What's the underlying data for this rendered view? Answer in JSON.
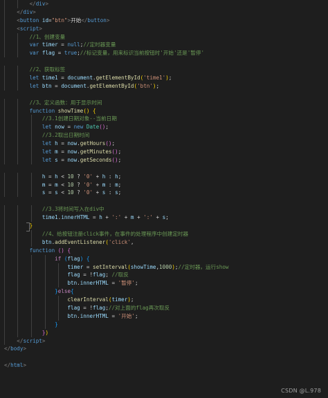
{
  "code": {
    "lines": [
      {
        "id": "l1",
        "indent": 2,
        "tokens": [
          {
            "c": "p",
            "t": "</"
          },
          {
            "c": "t",
            "t": "div"
          },
          {
            "c": "p",
            "t": ">"
          }
        ]
      },
      {
        "id": "l2",
        "indent": 1,
        "tokens": [
          {
            "c": "p",
            "t": "</"
          },
          {
            "c": "t",
            "t": "div"
          },
          {
            "c": "p",
            "t": ">"
          }
        ]
      },
      {
        "id": "l3",
        "indent": 1,
        "tokens": [
          {
            "c": "p",
            "t": "<"
          },
          {
            "c": "t",
            "t": "button"
          },
          {
            "c": "o",
            "t": " "
          },
          {
            "c": "a",
            "t": "id"
          },
          {
            "c": "o",
            "t": "="
          },
          {
            "c": "s",
            "t": "\"btn\""
          },
          {
            "c": "p",
            "t": ">"
          },
          {
            "c": "o",
            "t": "开始"
          },
          {
            "c": "p",
            "t": "</"
          },
          {
            "c": "t",
            "t": "button"
          },
          {
            "c": "p",
            "t": ">"
          }
        ]
      },
      {
        "id": "l4",
        "indent": 1,
        "tokens": [
          {
            "c": "p",
            "t": "<"
          },
          {
            "c": "t",
            "t": "script"
          },
          {
            "c": "p",
            "t": ">"
          }
        ]
      },
      {
        "id": "l5",
        "indent": 2,
        "tokens": [
          {
            "c": "c",
            "t": "//1、创建变量"
          }
        ]
      },
      {
        "id": "l6",
        "indent": 2,
        "tokens": [
          {
            "c": "k",
            "t": "var"
          },
          {
            "c": "o",
            "t": " "
          },
          {
            "c": "v",
            "t": "timer"
          },
          {
            "c": "o",
            "t": " = "
          },
          {
            "c": "k",
            "t": "null"
          },
          {
            "c": "o",
            "t": ";"
          },
          {
            "c": "c",
            "t": "//定时器变量"
          }
        ]
      },
      {
        "id": "l7",
        "indent": 2,
        "tokens": [
          {
            "c": "k",
            "t": "var"
          },
          {
            "c": "o",
            "t": " "
          },
          {
            "c": "v",
            "t": "flag"
          },
          {
            "c": "o",
            "t": " = "
          },
          {
            "c": "k",
            "t": "true"
          },
          {
            "c": "o",
            "t": ";"
          },
          {
            "c": "c",
            "t": "//标记变量，用来标识当前按钮时'开始'还是'暂停'"
          }
        ]
      },
      {
        "id": "l8",
        "indent": 0,
        "tokens": []
      },
      {
        "id": "l9",
        "indent": 2,
        "tokens": [
          {
            "c": "c",
            "t": "//2、获取标签"
          }
        ]
      },
      {
        "id": "l10",
        "indent": 2,
        "tokens": [
          {
            "c": "k",
            "t": "let"
          },
          {
            "c": "o",
            "t": " "
          },
          {
            "c": "v",
            "t": "time1"
          },
          {
            "c": "o",
            "t": " = "
          },
          {
            "c": "v",
            "t": "document"
          },
          {
            "c": "o",
            "t": "."
          },
          {
            "c": "f",
            "t": "getElementById"
          },
          {
            "c": "b1",
            "t": "("
          },
          {
            "c": "s",
            "t": "'time1'"
          },
          {
            "c": "b1",
            "t": ")"
          },
          {
            "c": "o",
            "t": ";"
          }
        ]
      },
      {
        "id": "l11",
        "indent": 2,
        "tokens": [
          {
            "c": "k",
            "t": "let"
          },
          {
            "c": "o",
            "t": " "
          },
          {
            "c": "v",
            "t": "btn"
          },
          {
            "c": "o",
            "t": " = "
          },
          {
            "c": "v",
            "t": "document"
          },
          {
            "c": "o",
            "t": "."
          },
          {
            "c": "f",
            "t": "getElementById"
          },
          {
            "c": "b1",
            "t": "("
          },
          {
            "c": "s",
            "t": "'btn'"
          },
          {
            "c": "b1",
            "t": ")"
          },
          {
            "c": "o",
            "t": ";"
          }
        ]
      },
      {
        "id": "l12",
        "indent": 0,
        "tokens": []
      },
      {
        "id": "l13",
        "indent": 2,
        "tokens": [
          {
            "c": "c",
            "t": "//3、定义函数：用于显示时间"
          }
        ]
      },
      {
        "id": "l14",
        "indent": 2,
        "tokens": [
          {
            "c": "k",
            "t": "function"
          },
          {
            "c": "o",
            "t": " "
          },
          {
            "c": "f",
            "t": "showTime"
          },
          {
            "c": "b1",
            "t": "()"
          },
          {
            "c": "o",
            "t": " "
          },
          {
            "c": "b1",
            "t": "{"
          }
        ]
      },
      {
        "id": "l15",
        "indent": 3,
        "tokens": [
          {
            "c": "c",
            "t": "//3.1创建日期对象--当前日期"
          }
        ]
      },
      {
        "id": "l16",
        "indent": 3,
        "tokens": [
          {
            "c": "k",
            "t": "let"
          },
          {
            "c": "o",
            "t": " "
          },
          {
            "c": "v",
            "t": "now"
          },
          {
            "c": "o",
            "t": " = "
          },
          {
            "c": "k",
            "t": "new"
          },
          {
            "c": "o",
            "t": " "
          },
          {
            "c": "cl",
            "t": "Date"
          },
          {
            "c": "b2",
            "t": "()"
          },
          {
            "c": "o",
            "t": ";"
          }
        ]
      },
      {
        "id": "l17",
        "indent": 3,
        "tokens": [
          {
            "c": "c",
            "t": "//3.2取出日期时间"
          }
        ]
      },
      {
        "id": "l18",
        "indent": 3,
        "tokens": [
          {
            "c": "k",
            "t": "let"
          },
          {
            "c": "o",
            "t": " "
          },
          {
            "c": "v",
            "t": "h"
          },
          {
            "c": "o",
            "t": " = "
          },
          {
            "c": "v",
            "t": "now"
          },
          {
            "c": "o",
            "t": "."
          },
          {
            "c": "f",
            "t": "getHours"
          },
          {
            "c": "b2",
            "t": "()"
          },
          {
            "c": "o",
            "t": ";"
          }
        ]
      },
      {
        "id": "l19",
        "indent": 3,
        "tokens": [
          {
            "c": "k",
            "t": "let"
          },
          {
            "c": "o",
            "t": " "
          },
          {
            "c": "v",
            "t": "m"
          },
          {
            "c": "o",
            "t": " = "
          },
          {
            "c": "v",
            "t": "now"
          },
          {
            "c": "o",
            "t": "."
          },
          {
            "c": "f",
            "t": "getMinutes"
          },
          {
            "c": "b2",
            "t": "()"
          },
          {
            "c": "o",
            "t": ";"
          }
        ]
      },
      {
        "id": "l20",
        "indent": 3,
        "tokens": [
          {
            "c": "k",
            "t": "let"
          },
          {
            "c": "o",
            "t": " "
          },
          {
            "c": "v",
            "t": "s"
          },
          {
            "c": "o",
            "t": " = "
          },
          {
            "c": "v",
            "t": "now"
          },
          {
            "c": "o",
            "t": "."
          },
          {
            "c": "f",
            "t": "getSeconds"
          },
          {
            "c": "b2",
            "t": "()"
          },
          {
            "c": "o",
            "t": ";"
          }
        ]
      },
      {
        "id": "l21",
        "indent": 0,
        "tokens": []
      },
      {
        "id": "l22",
        "indent": 3,
        "tokens": [
          {
            "c": "v",
            "t": "h"
          },
          {
            "c": "o",
            "t": " = "
          },
          {
            "c": "v",
            "t": "h"
          },
          {
            "c": "o",
            "t": " < "
          },
          {
            "c": "n",
            "t": "10"
          },
          {
            "c": "o",
            "t": " ? "
          },
          {
            "c": "s",
            "t": "'0'"
          },
          {
            "c": "o",
            "t": " + "
          },
          {
            "c": "v",
            "t": "h"
          },
          {
            "c": "o",
            "t": " : "
          },
          {
            "c": "v",
            "t": "h"
          },
          {
            "c": "o",
            "t": ";"
          }
        ]
      },
      {
        "id": "l23",
        "indent": 3,
        "tokens": [
          {
            "c": "v",
            "t": "m"
          },
          {
            "c": "o",
            "t": " = "
          },
          {
            "c": "v",
            "t": "m"
          },
          {
            "c": "o",
            "t": " < "
          },
          {
            "c": "n",
            "t": "10"
          },
          {
            "c": "o",
            "t": " ? "
          },
          {
            "c": "s",
            "t": "'0'"
          },
          {
            "c": "o",
            "t": " + "
          },
          {
            "c": "v",
            "t": "m"
          },
          {
            "c": "o",
            "t": " : "
          },
          {
            "c": "v",
            "t": "m"
          },
          {
            "c": "o",
            "t": ";"
          }
        ]
      },
      {
        "id": "l24",
        "indent": 3,
        "tokens": [
          {
            "c": "v",
            "t": "s"
          },
          {
            "c": "o",
            "t": " = "
          },
          {
            "c": "v",
            "t": "s"
          },
          {
            "c": "o",
            "t": " < "
          },
          {
            "c": "n",
            "t": "10"
          },
          {
            "c": "o",
            "t": " ? "
          },
          {
            "c": "s",
            "t": "'0'"
          },
          {
            "c": "o",
            "t": " + "
          },
          {
            "c": "v",
            "t": "s"
          },
          {
            "c": "o",
            "t": " : "
          },
          {
            "c": "v",
            "t": "s"
          },
          {
            "c": "o",
            "t": ";"
          }
        ]
      },
      {
        "id": "l25",
        "indent": 0,
        "tokens": []
      },
      {
        "id": "l26",
        "indent": 3,
        "tokens": [
          {
            "c": "c",
            "t": "//3.3将时间写入在div中"
          }
        ]
      },
      {
        "id": "l27",
        "indent": 3,
        "tokens": [
          {
            "c": "v",
            "t": "time1"
          },
          {
            "c": "o",
            "t": "."
          },
          {
            "c": "v",
            "t": "innerHTML"
          },
          {
            "c": "o",
            "t": " = "
          },
          {
            "c": "v",
            "t": "h"
          },
          {
            "c": "o",
            "t": " + "
          },
          {
            "c": "s",
            "t": "':'"
          },
          {
            "c": "o",
            "t": " + "
          },
          {
            "c": "v",
            "t": "m"
          },
          {
            "c": "o",
            "t": " + "
          },
          {
            "c": "s",
            "t": "':'"
          },
          {
            "c": "o",
            "t": " + "
          },
          {
            "c": "v",
            "t": "s"
          },
          {
            "c": "o",
            "t": ";"
          }
        ]
      },
      {
        "id": "l28",
        "indent": 2,
        "tokens": [
          {
            "c": "b1",
            "t": "}"
          }
        ]
      },
      {
        "id": "l29",
        "indent": 3,
        "tokens": [
          {
            "c": "c",
            "t": "//4、给按钮注册click事件，在事件的处理程序中创建定时器"
          }
        ]
      },
      {
        "id": "l30",
        "indent": 3,
        "tokens": [
          {
            "c": "v",
            "t": "btn"
          },
          {
            "c": "o",
            "t": "."
          },
          {
            "c": "f",
            "t": "addEventListener"
          },
          {
            "c": "b1",
            "t": "("
          },
          {
            "c": "s",
            "t": "'click'"
          },
          {
            "c": "o",
            "t": ","
          }
        ]
      },
      {
        "id": "l31",
        "indent": 2,
        "tokens": [
          {
            "c": "k",
            "t": "function"
          },
          {
            "c": "o",
            "t": " "
          },
          {
            "c": "b2",
            "t": "()"
          },
          {
            "c": "o",
            "t": " "
          },
          {
            "c": "b2",
            "t": "{"
          }
        ]
      },
      {
        "id": "l32",
        "indent": 4,
        "tokens": [
          {
            "c": "kc",
            "t": "if"
          },
          {
            "c": "o",
            "t": " "
          },
          {
            "c": "b3",
            "t": "("
          },
          {
            "c": "v",
            "t": "flag"
          },
          {
            "c": "b3",
            "t": ")"
          },
          {
            "c": "o",
            "t": " "
          },
          {
            "c": "b3",
            "t": "{"
          }
        ]
      },
      {
        "id": "l33",
        "indent": 5,
        "tokens": [
          {
            "c": "v",
            "t": "timer"
          },
          {
            "c": "o",
            "t": " = "
          },
          {
            "c": "f",
            "t": "setInterval"
          },
          {
            "c": "b1",
            "t": "("
          },
          {
            "c": "v",
            "t": "showTime"
          },
          {
            "c": "o",
            "t": ","
          },
          {
            "c": "n",
            "t": "1000"
          },
          {
            "c": "b1",
            "t": ")"
          },
          {
            "c": "o",
            "t": ";"
          },
          {
            "c": "c",
            "t": "//定时器，运行show"
          }
        ]
      },
      {
        "id": "l34",
        "indent": 5,
        "tokens": [
          {
            "c": "v",
            "t": "flag"
          },
          {
            "c": "o",
            "t": " = !"
          },
          {
            "c": "v",
            "t": "flag"
          },
          {
            "c": "o",
            "t": "; "
          },
          {
            "c": "c",
            "t": "//取反"
          }
        ]
      },
      {
        "id": "l35",
        "indent": 5,
        "tokens": [
          {
            "c": "v",
            "t": "btn"
          },
          {
            "c": "o",
            "t": "."
          },
          {
            "c": "v",
            "t": "innerHTML"
          },
          {
            "c": "o",
            "t": " = "
          },
          {
            "c": "s",
            "t": "'暂停'"
          },
          {
            "c": "o",
            "t": ";"
          }
        ]
      },
      {
        "id": "l36",
        "indent": 4,
        "tokens": [
          {
            "c": "b3",
            "t": "}"
          },
          {
            "c": "kc",
            "t": "else"
          },
          {
            "c": "b3",
            "t": "{"
          }
        ]
      },
      {
        "id": "l37",
        "indent": 5,
        "tokens": [
          {
            "c": "f",
            "t": "clearInterval"
          },
          {
            "c": "b1",
            "t": "("
          },
          {
            "c": "v",
            "t": "timer"
          },
          {
            "c": "b1",
            "t": ")"
          },
          {
            "c": "o",
            "t": ";"
          }
        ]
      },
      {
        "id": "l38",
        "indent": 5,
        "tokens": [
          {
            "c": "v",
            "t": "flag"
          },
          {
            "c": "o",
            "t": " = !"
          },
          {
            "c": "v",
            "t": "flag"
          },
          {
            "c": "o",
            "t": ";"
          },
          {
            "c": "c",
            "t": "//对上面的flag再次取反"
          }
        ]
      },
      {
        "id": "l39",
        "indent": 5,
        "tokens": [
          {
            "c": "v",
            "t": "btn"
          },
          {
            "c": "o",
            "t": "."
          },
          {
            "c": "v",
            "t": "innerHTML"
          },
          {
            "c": "o",
            "t": " = "
          },
          {
            "c": "s",
            "t": "'开始'"
          },
          {
            "c": "o",
            "t": ";"
          }
        ]
      },
      {
        "id": "l40",
        "indent": 4,
        "tokens": [
          {
            "c": "b3",
            "t": "}"
          }
        ]
      },
      {
        "id": "l41",
        "indent": 3,
        "tokens": [
          {
            "c": "b2",
            "t": "}"
          },
          {
            "c": "b1",
            "t": ")"
          }
        ]
      },
      {
        "id": "l42",
        "indent": 1,
        "tokens": [
          {
            "c": "p",
            "t": "</"
          },
          {
            "c": "t",
            "t": "script"
          },
          {
            "c": "p",
            "t": ">"
          }
        ]
      },
      {
        "id": "l43",
        "indent": 0,
        "tokens": [
          {
            "c": "p",
            "t": "</"
          },
          {
            "c": "t",
            "t": "body"
          },
          {
            "c": "p",
            "t": ">"
          }
        ]
      },
      {
        "id": "l44",
        "indent": 0,
        "tokens": []
      },
      {
        "id": "l45",
        "indent": 0,
        "tokens": [
          {
            "c": "p",
            "t": "</"
          },
          {
            "c": "t",
            "t": "html"
          },
          {
            "c": "p",
            "t": ">"
          }
        ]
      }
    ]
  },
  "watermark": "CSDN @L.978"
}
